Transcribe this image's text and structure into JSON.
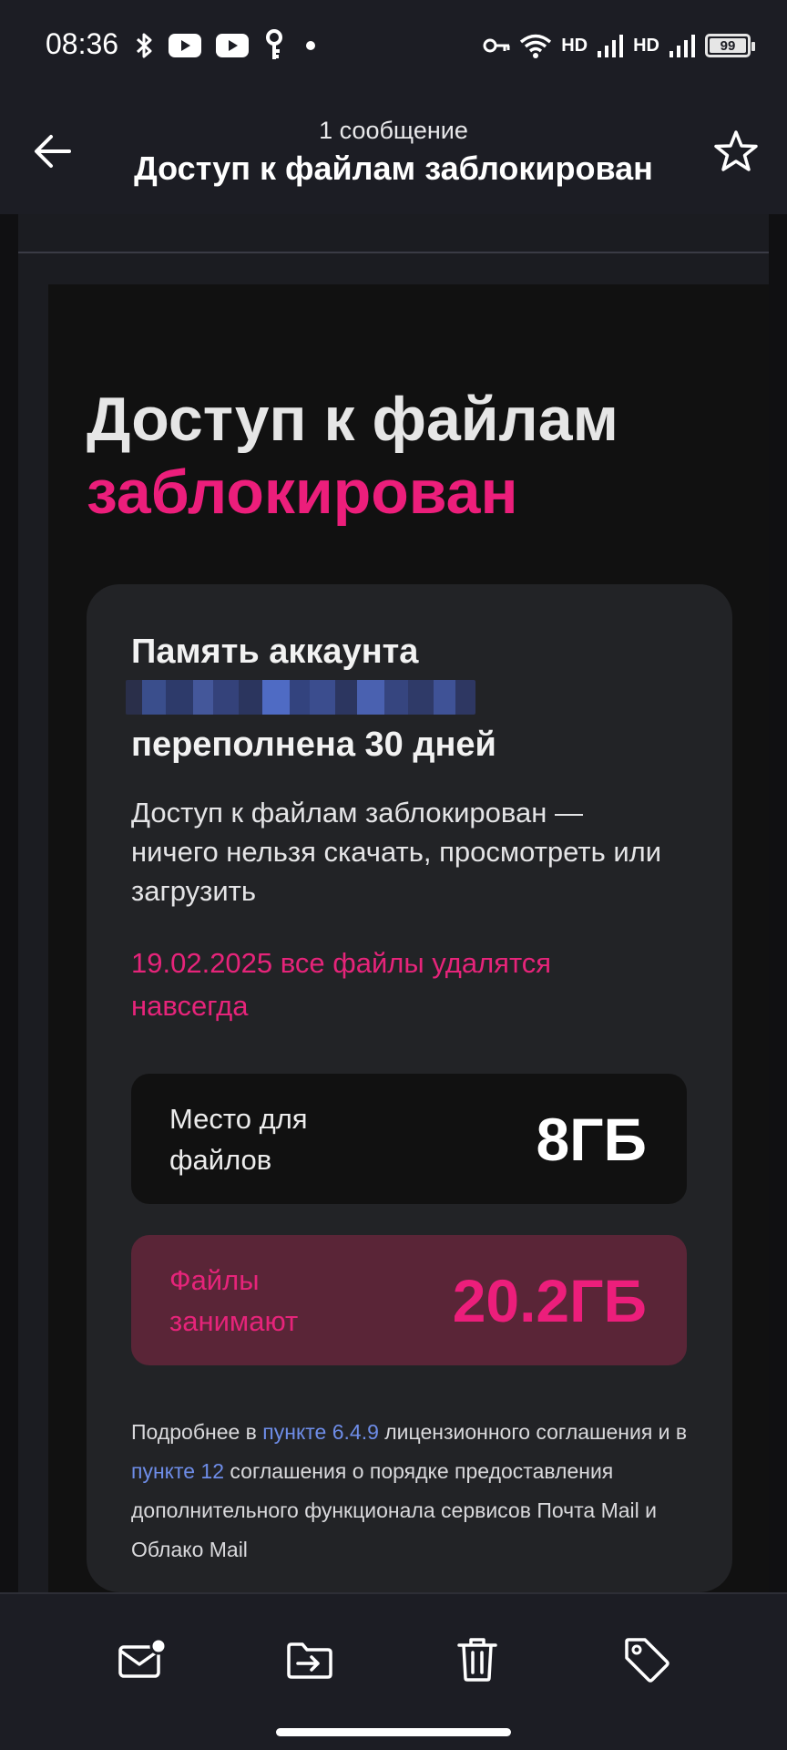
{
  "status_bar": {
    "time": "08:36",
    "hd1": "HD",
    "hd2": "HD",
    "battery": "99",
    "icons": [
      "bluetooth-icon",
      "youtube-icon",
      "youtube-icon",
      "key-icon",
      "dot-icon",
      "vpn-key-icon",
      "wifi-icon",
      "signal-icon",
      "signal-icon",
      "battery-icon"
    ]
  },
  "header": {
    "subtitle": "1 сообщение",
    "title": "Доступ к файлам заблокирован",
    "back_icon": "arrow-left-icon",
    "star_icon": "star-outline-icon"
  },
  "email": {
    "headline_line1": "Доступ к файлам",
    "headline_line2": "заблокирован",
    "card": {
      "title_line1": "Память аккаунта",
      "title_line2": "переполнена 30 дней",
      "description": "Доступ к файлам заблокирован — ничего нельзя скачать, просмотреть или загрузить",
      "warning": "19.02.2025 все файлы удалятся навсегда",
      "space_label": "Место для файлов",
      "space_value": "8ГБ",
      "used_label": "Файлы занимают",
      "used_value": "20.2ГБ",
      "footnote": {
        "part1": "Подробнее в ",
        "link1": "пункте 6.4.9",
        "part2": " лицензионного соглашения и в ",
        "link2": "пункте 12",
        "part3": " соглашения о порядке предоставления дополнительного функционала сервисов Почта Mail и Облако Mail"
      }
    }
  },
  "toolbar": {
    "icons": [
      "mark-unread-icon",
      "move-to-folder-icon",
      "trash-icon",
      "tag-icon"
    ]
  },
  "colors": {
    "accent": "#ec1e7b",
    "link": "#6e8de8",
    "background": "#1c1d24"
  }
}
